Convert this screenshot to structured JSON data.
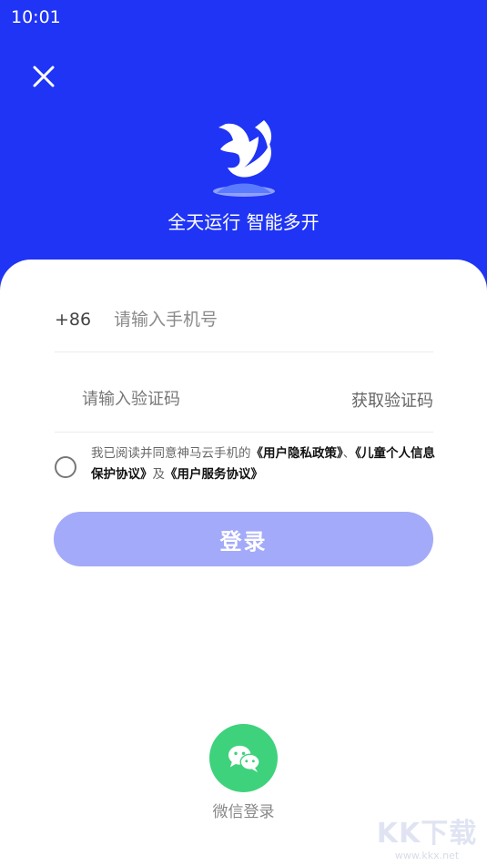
{
  "status_bar": {
    "time": "10:01"
  },
  "header": {
    "slogan": "全天运行 智能多开",
    "accent_color": "#1f34f5"
  },
  "form": {
    "country_code": "+86",
    "phone_placeholder": "请输入手机号",
    "code_placeholder": "请输入验证码",
    "get_code_label": "获取验证码"
  },
  "agreement": {
    "prefix": "我已阅读并同意神马云手机的",
    "privacy_link": "《用户隐私政策》",
    "separator": "、",
    "children_link": "《儿童个人信息保护协议》",
    "and": "及",
    "service_link": "《用户服务协议》"
  },
  "login": {
    "button_label": "登录",
    "button_color": "#a3aaf9"
  },
  "wechat": {
    "label": "微信登录",
    "icon": "wechat-icon",
    "color": "#3ed27c"
  },
  "watermark": {
    "logo_text": "KK下载",
    "url": "www.kkx.net"
  }
}
